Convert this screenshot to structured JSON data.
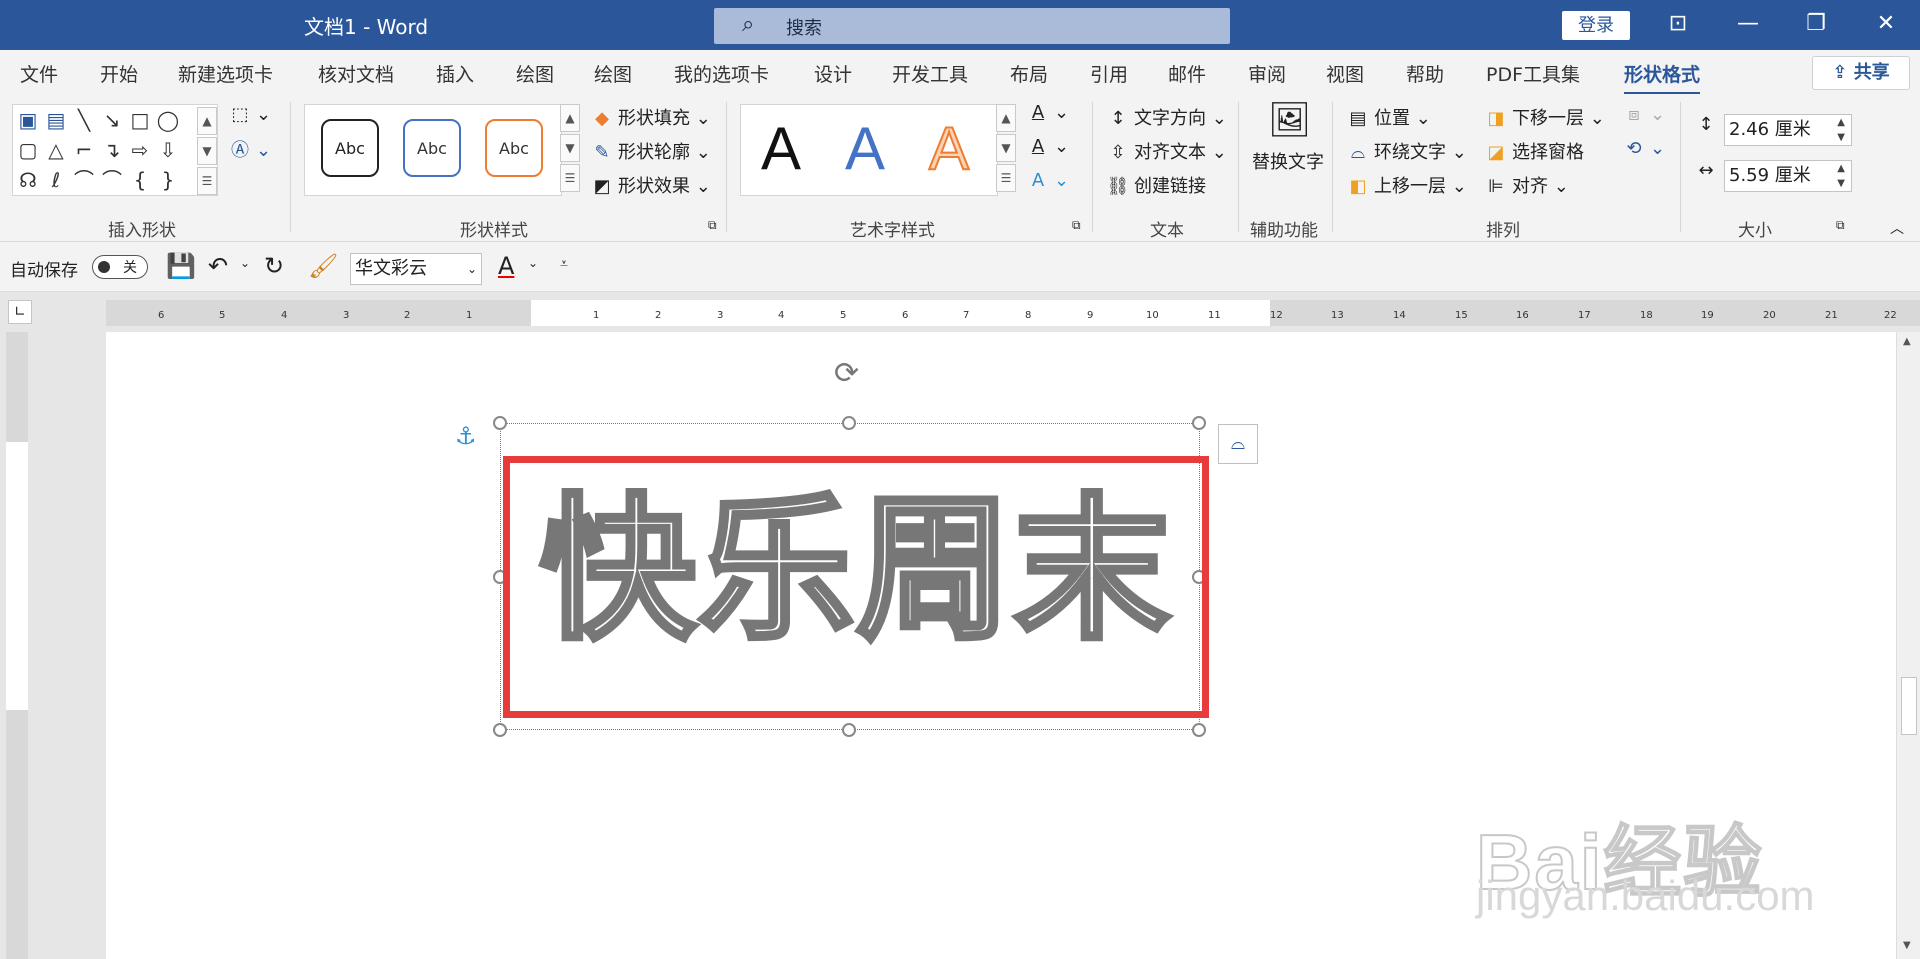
{
  "window": {
    "title": "文档1  -  Word",
    "search_placeholder": "搜索",
    "login": "登录"
  },
  "menu": {
    "tabs": [
      "文件",
      "开始",
      "新建选项卡",
      "核对文档",
      "插入",
      "绘图",
      "绘图",
      "我的选项卡",
      "设计",
      "开发工具",
      "布局",
      "引用",
      "邮件",
      "审阅",
      "视图",
      "帮助",
      "PDF工具集",
      "形状格式"
    ],
    "share": "共享"
  },
  "ribbon": {
    "groups": {
      "insert_shapes": "插入形状",
      "shape_styles": "形状样式",
      "wordart_styles": "艺术字样式",
      "text": "文本",
      "accessibility": "辅助功能",
      "arrange": "排列",
      "size": "大小"
    },
    "shape_styles": {
      "abc1": "Abc",
      "abc2": "Abc",
      "abc3": "Abc",
      "fill": "形状填充",
      "outline": "形状轮廓",
      "effects": "形状效果"
    },
    "wordart": {
      "a1": "A",
      "a2": "A",
      "a3": "A"
    },
    "text": {
      "direction": "文字方向",
      "align": "对齐文本",
      "link": "创建链接"
    },
    "accessibility": {
      "alt_text": "替换文字"
    },
    "arrange": {
      "position": "位置",
      "wrap": "环绕文字",
      "forward": "上移一层",
      "backward": "下移一层",
      "pane": "选择窗格",
      "align": "对齐"
    },
    "size": {
      "height": "2.46 厘米",
      "width": "5.59 厘米"
    }
  },
  "qat": {
    "autosave": "自动保存",
    "toggle_state": "关",
    "font": "华文彩云"
  },
  "ruler": {
    "ticks": [
      "6",
      "5",
      "4",
      "3",
      "2",
      "1",
      "",
      "1",
      "2",
      "3",
      "4",
      "5",
      "6",
      "7",
      "8",
      "9",
      "10",
      "11",
      "12",
      "13",
      "14",
      "15",
      "16",
      "17",
      "18",
      "19",
      "20",
      "21",
      "22"
    ]
  },
  "document": {
    "wordart_text": "快乐周末",
    "watermark": "Bai经验",
    "watermark_url": "jingyan.baidu.com"
  },
  "colors": {
    "word_blue": "#2b579a",
    "red_highlight": "#e73c3c"
  }
}
